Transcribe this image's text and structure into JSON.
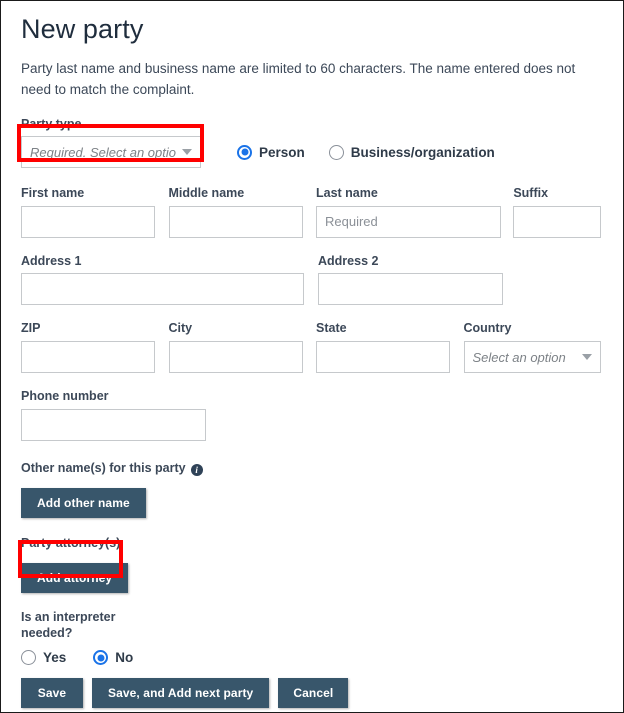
{
  "page": {
    "title": "New party",
    "description": "Party last name and business name are limited to 60 characters. The name entered does not need to match the complaint."
  },
  "party_type": {
    "label": "Party type",
    "dropdown_placeholder": "Required. Select an option",
    "caret_icon": "chevron-down-icon",
    "options_radio": [
      {
        "label": "Person",
        "selected": true
      },
      {
        "label": "Business/organization",
        "selected": false
      }
    ]
  },
  "name_fields": {
    "first_name": {
      "label": "First name",
      "value": "",
      "placeholder": ""
    },
    "middle_name": {
      "label": "Middle name",
      "value": "",
      "placeholder": ""
    },
    "last_name": {
      "label": "Last name",
      "value": "",
      "placeholder": "Required"
    },
    "suffix": {
      "label": "Suffix",
      "value": "",
      "placeholder": ""
    }
  },
  "address_fields": {
    "address1": {
      "label": "Address 1",
      "value": "",
      "placeholder": ""
    },
    "address2": {
      "label": "Address 2",
      "value": "",
      "placeholder": ""
    },
    "zip": {
      "label": "ZIP",
      "value": "",
      "placeholder": ""
    },
    "city": {
      "label": "City",
      "value": "",
      "placeholder": ""
    },
    "state": {
      "label": "State",
      "value": "",
      "placeholder": ""
    },
    "country": {
      "label": "Country",
      "dropdown_placeholder": "Select an option",
      "caret_icon": "chevron-down-icon"
    }
  },
  "phone": {
    "label": "Phone number",
    "value": "",
    "placeholder": ""
  },
  "other_names": {
    "label": "Other name(s) for this party",
    "info_icon": "info-icon",
    "button_label": "Add other name"
  },
  "attorneys": {
    "label": "Party attorney(s)",
    "button_label": "Add attorney"
  },
  "interpreter": {
    "label": "Is an interpreter needed?",
    "options": [
      {
        "label": "Yes",
        "selected": false
      },
      {
        "label": "No",
        "selected": true
      }
    ]
  },
  "actions": {
    "save_label": "Save",
    "save_next_label": "Save, and Add next party",
    "cancel_label": "Cancel"
  },
  "colors": {
    "button_bg": "#38566b",
    "radio_accent": "#1a73e8",
    "annotation": "#ff0000",
    "label_text": "#3c4858",
    "placeholder_text": "#8b9097",
    "input_border": "#c6c9cc"
  },
  "annotations": [
    {
      "name": "party-type-dropdown-highlight",
      "color": "#ff0000"
    },
    {
      "name": "add-attorney-highlight",
      "color": "#ff0000"
    }
  ]
}
